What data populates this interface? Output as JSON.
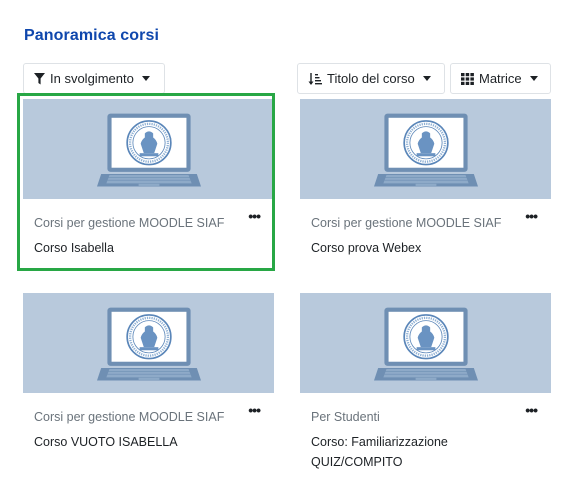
{
  "page": {
    "title": "Panoramica corsi"
  },
  "toolbar": {
    "filter_label": "In svolgimento",
    "sort_label": "Titolo del corso",
    "view_label": "Matrice"
  },
  "courses": [
    {
      "category": "Corsi per gestione MOODLE SIAF",
      "name": "Corso Isabella",
      "menu": "•••"
    },
    {
      "category": "Corsi per gestione MOODLE SIAF",
      "name": "Corso prova Webex",
      "menu": "•••"
    },
    {
      "category": "Corsi per gestione MOODLE SIAF",
      "name": "Corso VUOTO ISABELLA",
      "menu": "•••"
    },
    {
      "category": "Per Studenti",
      "name": "Corso: Familiarizzazione QUIZ/COMPITO",
      "menu": "•••"
    }
  ],
  "colors": {
    "title": "#0f47ad",
    "thumb_bg": "#b8c9dc",
    "highlight": "#28a745"
  }
}
